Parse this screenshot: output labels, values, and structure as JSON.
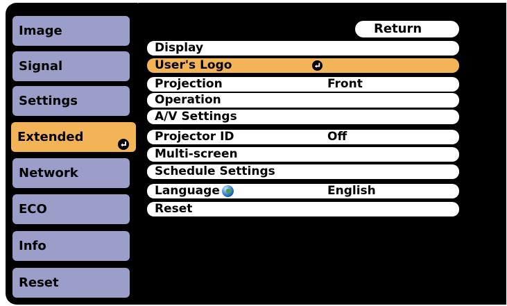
{
  "sidebar": {
    "tabs": [
      {
        "label": "Image"
      },
      {
        "label": "Signal"
      },
      {
        "label": "Settings"
      },
      {
        "label": "Extended"
      },
      {
        "label": "Network"
      },
      {
        "label": "ECO"
      },
      {
        "label": "Info"
      },
      {
        "label": "Reset"
      }
    ],
    "active_tab": "Extended"
  },
  "main": {
    "return_label": "Return",
    "items": [
      {
        "label": "Display",
        "value": ""
      },
      {
        "label": "User's Logo",
        "value": ""
      },
      {
        "label": "Projection",
        "value": "Front"
      },
      {
        "label": "Operation",
        "value": ""
      },
      {
        "label": "A/V Settings",
        "value": ""
      },
      {
        "label": "Projector ID",
        "value": "Off"
      },
      {
        "label": "Multi-screen",
        "value": ""
      },
      {
        "label": "Schedule Settings",
        "value": ""
      },
      {
        "label": "Language",
        "value": "English"
      },
      {
        "label": "Reset",
        "value": ""
      }
    ],
    "selected_item": "User's Logo"
  },
  "colors": {
    "tab_bg": "#9a9ec8",
    "highlight": "#f2b457",
    "panel_bg": "#000000",
    "row_bg": "#ffffff"
  },
  "icons": {
    "enter": "enter-icon",
    "language": "globe-icon"
  }
}
